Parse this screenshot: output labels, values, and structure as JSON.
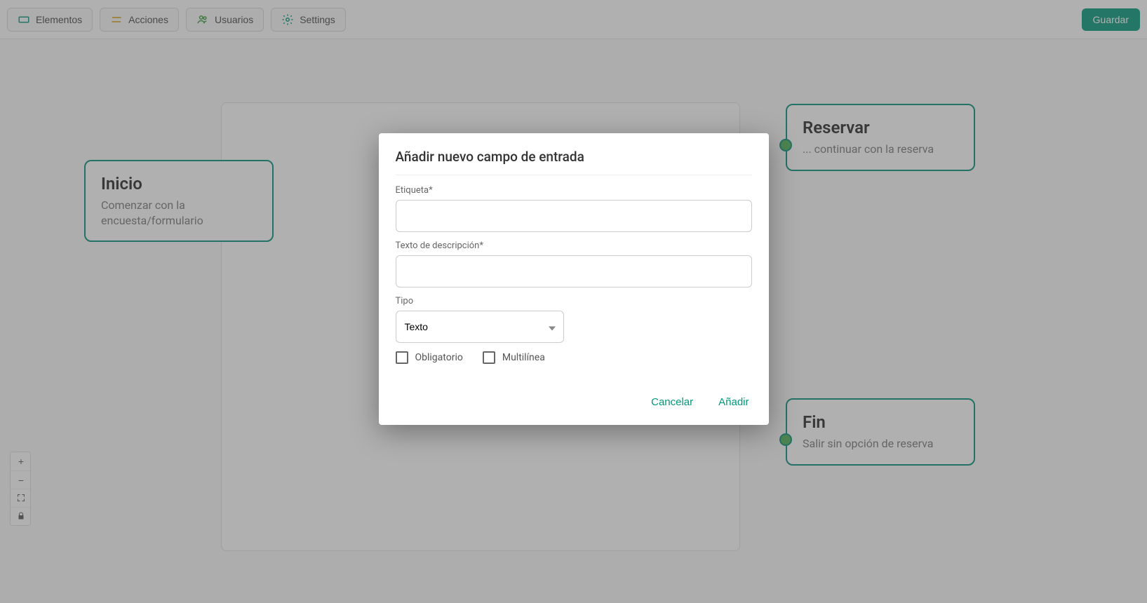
{
  "toolbar": {
    "elements_label": "Elementos",
    "actions_label": "Acciones",
    "users_label": "Usuarios",
    "settings_label": "Settings",
    "save_label": "Guardar"
  },
  "nodes": {
    "start": {
      "title": "Inicio",
      "subtitle": "Comenzar con la encuesta/formulario"
    },
    "reserve": {
      "title": "Reservar",
      "subtitle": "... continuar con la reserva"
    },
    "end": {
      "title": "Fin",
      "subtitle": "Salir sin opción de reserva"
    }
  },
  "modal": {
    "title": "Añadir nuevo campo de entrada",
    "label_field": "Etiqueta*",
    "description_field": "Texto de descripción*",
    "type_field": "Tipo",
    "type_value": "Texto",
    "required_label": "Obligatorio",
    "multiline_label": "Multilínea",
    "cancel_label": "Cancelar",
    "add_label": "Añadir"
  },
  "zoom": {
    "in": "+",
    "out": "−",
    "fit": "⛶",
    "lock": "🔒"
  }
}
